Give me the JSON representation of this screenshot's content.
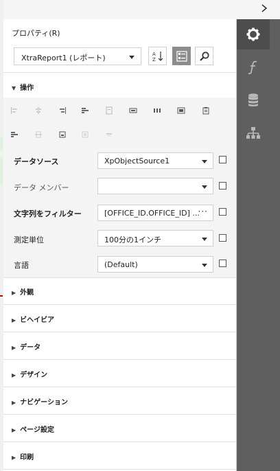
{
  "panel": {
    "title": "プロパティ(R)"
  },
  "report_selector": {
    "value": "XtraReport1 (レポート)"
  },
  "groups": {
    "operations": "操作",
    "appearance": "外観",
    "behavior": "ビヘイビア",
    "data": "データ",
    "design": "デザイン",
    "navigation": "ナビゲーション",
    "page_settings": "ページ設定",
    "print": "印刷"
  },
  "properties": [
    {
      "label": "データソース",
      "value": "XpObjectSource1",
      "editor": "dropdown"
    },
    {
      "label": "データ メンバー",
      "value": "",
      "editor": "dropdown"
    },
    {
      "label": "文字列をフィルター",
      "value": "[OFFICE_ID.OFFICE_ID] ...",
      "editor": "ellipsis"
    },
    {
      "label": "測定単位",
      "value": "100分の1インチ",
      "editor": "dropdown"
    },
    {
      "label": "言語",
      "value": "(Default)",
      "editor": "dropdown"
    }
  ],
  "icons": {
    "collapse": "chevron-right-icon",
    "sort_alphabetical": "sort-az-icon",
    "categorized_view": "categorized-icon",
    "search": "search-icon",
    "tab_properties": "gear-icon",
    "tab_expressions": "function-icon",
    "tab_field_list": "database-icon",
    "tab_report_explorer": "hierarchy-icon"
  },
  "colors": {
    "sidebar_bg": "#5f5f5f",
    "sidebar_active": "#4d4d4d",
    "active_toggle": "#8c8c8c"
  }
}
